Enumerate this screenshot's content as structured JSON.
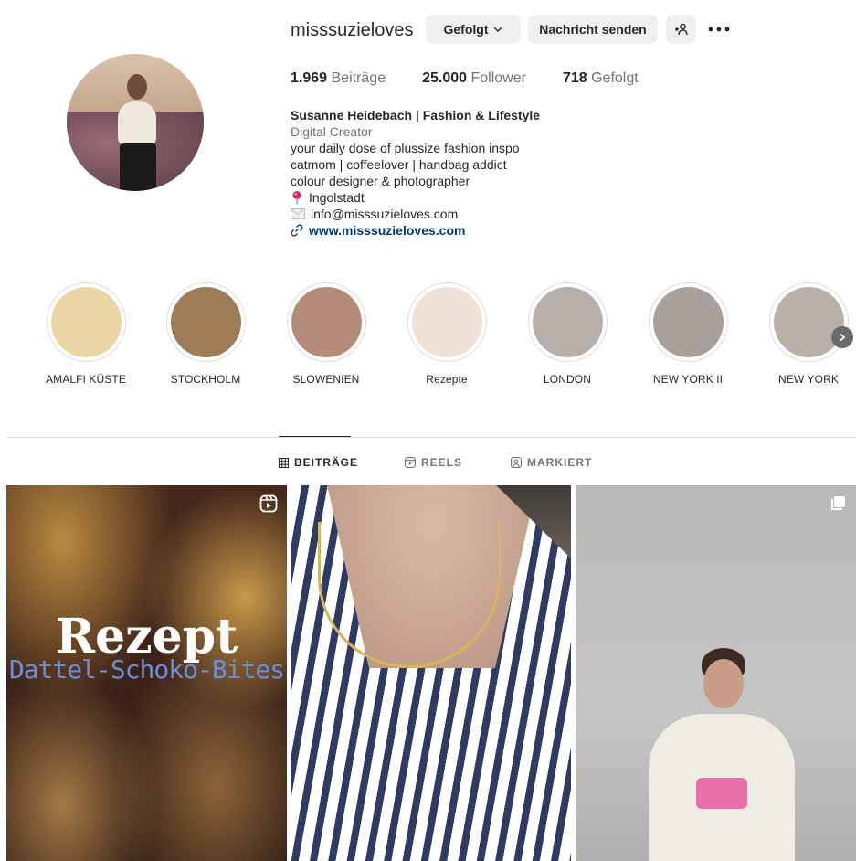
{
  "profile": {
    "username": "misssuzieloves",
    "follow_button": "Gefolgt",
    "message_button": "Nachricht senden",
    "stats": {
      "posts_num": "1.969",
      "posts_label": "Beiträge",
      "followers_num": "25.000",
      "followers_label": "Follower",
      "following_num": "718",
      "following_label": "Gefolgt"
    },
    "bio": {
      "name": "Susanne Heidebach | Fashion & Lifestyle",
      "category": "Digital Creator",
      "line1": "your daily dose of plussize fashion inspo",
      "line2": "catmom | coffeelover | handbag addict",
      "line3": "colour designer & photographer",
      "location": "Ingolstadt",
      "email": "info@misssuzieloves.com",
      "website": "www.misssuzieloves.com"
    }
  },
  "highlights": [
    {
      "label": "AMALFI KÜSTE",
      "color": "#ecd5a5"
    },
    {
      "label": "STOCKHOLM",
      "color": "#9d7c58"
    },
    {
      "label": "SLOWENIEN",
      "color": "#b58c79"
    },
    {
      "label": "Rezepte",
      "color": "#f0e1d8"
    },
    {
      "label": "LONDON",
      "color": "#b6afaa"
    },
    {
      "label": "NEW YORK II",
      "color": "#a8a09a"
    },
    {
      "label": "NEW YORK",
      "color": "#b9b0a7"
    }
  ],
  "tabs": {
    "posts": "BEITRÄGE",
    "reels": "REELS",
    "tagged": "MARKIERT"
  },
  "posts": {
    "post1_title": "Rezept",
    "post1_subtitle": "Dattel-Schoko-Bites"
  },
  "icons": {
    "more": "more-horizontal-icon",
    "add_user": "add-user-icon",
    "location": "pin-icon",
    "email": "envelope-icon",
    "link": "link-icon",
    "reel": "reel-icon",
    "carousel": "carousel-icon"
  }
}
